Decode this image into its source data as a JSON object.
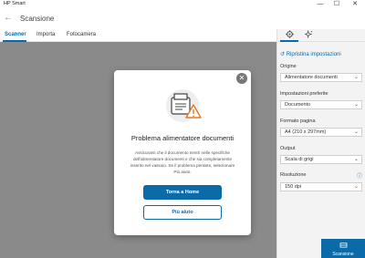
{
  "app": {
    "title": "HP Smart"
  },
  "window_controls": {
    "minimize": "—",
    "maximize": "☐",
    "close": "✕"
  },
  "header": {
    "back_icon": "←",
    "title": "Scansione"
  },
  "tabs": [
    {
      "label": "Scanner",
      "active": true
    },
    {
      "label": "Importa",
      "active": false
    },
    {
      "label": "Fotocamera",
      "active": false
    }
  ],
  "side_panel": {
    "tab_icons": {
      "settings": "gear-icon",
      "enhance": "sparkle-icon"
    },
    "reset_label": "Ripristina impostazioni",
    "fields": [
      {
        "label": "Origine",
        "value": "Alimentatore documenti"
      },
      {
        "label": "Impostazioni preferite",
        "value": "Documento"
      },
      {
        "label": "Formato pagina",
        "value": "A4 (210 x 297mm)"
      },
      {
        "label": "Output",
        "value": "Scala di grigi"
      },
      {
        "label": "Risoluzione",
        "value": "150 dpi"
      }
    ],
    "scan_button": "Scansione"
  },
  "dialog": {
    "title": "Problema alimentatore documenti",
    "body": "Assicurarsi che il documento rientri nelle specifiche dell'alimentatore documenti e che sia completamente inserito nel vassoio. Se il problema persiste, selezionare Più aiuto.",
    "primary_button": "Torna a Home",
    "secondary_button": "Più aiuto"
  },
  "colors": {
    "accent": "#0b6aa8",
    "overlay": "#8a8a8a",
    "warning": "#e07a2a"
  }
}
